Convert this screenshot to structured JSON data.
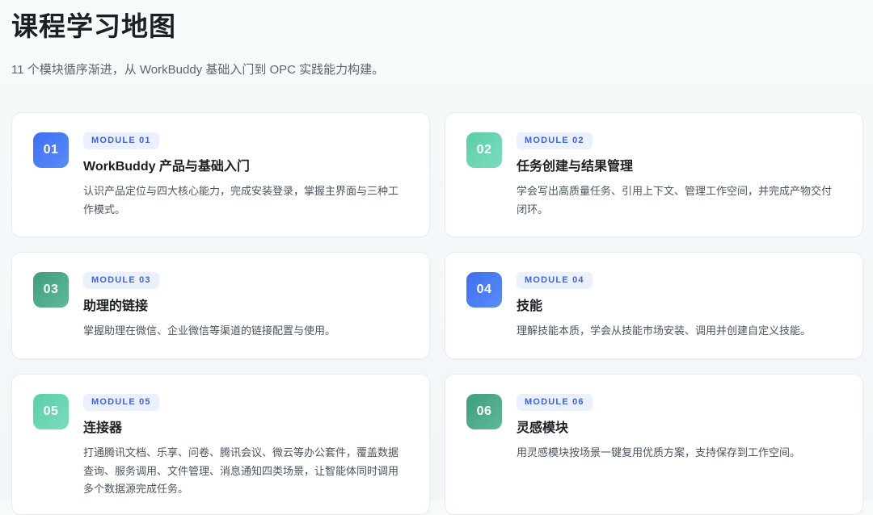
{
  "page": {
    "title": "课程学习地图",
    "subtitle": "11 个模块循序渐进，从 WorkBuddy 基础入门到 OPC 实践能力构建。"
  },
  "modules": [
    {
      "number": "01",
      "tag": "MODULE 01",
      "title": "WorkBuddy 产品与基础入门",
      "description": "认识产品定位与四大核心能力，完成安装登录，掌握主界面与三种工作模式。",
      "color": "#3d6ff2"
    },
    {
      "number": "02",
      "tag": "MODULE 02",
      "title": "任务创建与结果管理",
      "description": "学会写出高质量任务、引用上下文、管理工作空间，并完成产物交付闭环。",
      "color": "#58cfa6"
    },
    {
      "number": "03",
      "tag": "MODULE 03",
      "title": "助理的链接",
      "description": "掌握助理在微信、企业微信等渠道的链接配置与使用。",
      "color": "#3e9e80"
    },
    {
      "number": "04",
      "tag": "MODULE 04",
      "title": "技能",
      "description": "理解技能本质，学会从技能市场安装、调用并创建自定义技能。",
      "color": "#3d6ff2"
    },
    {
      "number": "05",
      "tag": "MODULE 05",
      "title": "连接器",
      "description": "打通腾讯文档、乐享、问卷、腾讯会议、微云等办公套件，覆盖数据查询、服务调用、文件管理、消息通知四类场景，让智能体同时调用多个数据源完成任务。",
      "color": "#58cfa6"
    },
    {
      "number": "06",
      "tag": "MODULE 06",
      "title": "灵感模块",
      "description": "用灵感模块按场景一键复用优质方案，支持保存到工作空间。",
      "color": "#3e9e80"
    }
  ]
}
